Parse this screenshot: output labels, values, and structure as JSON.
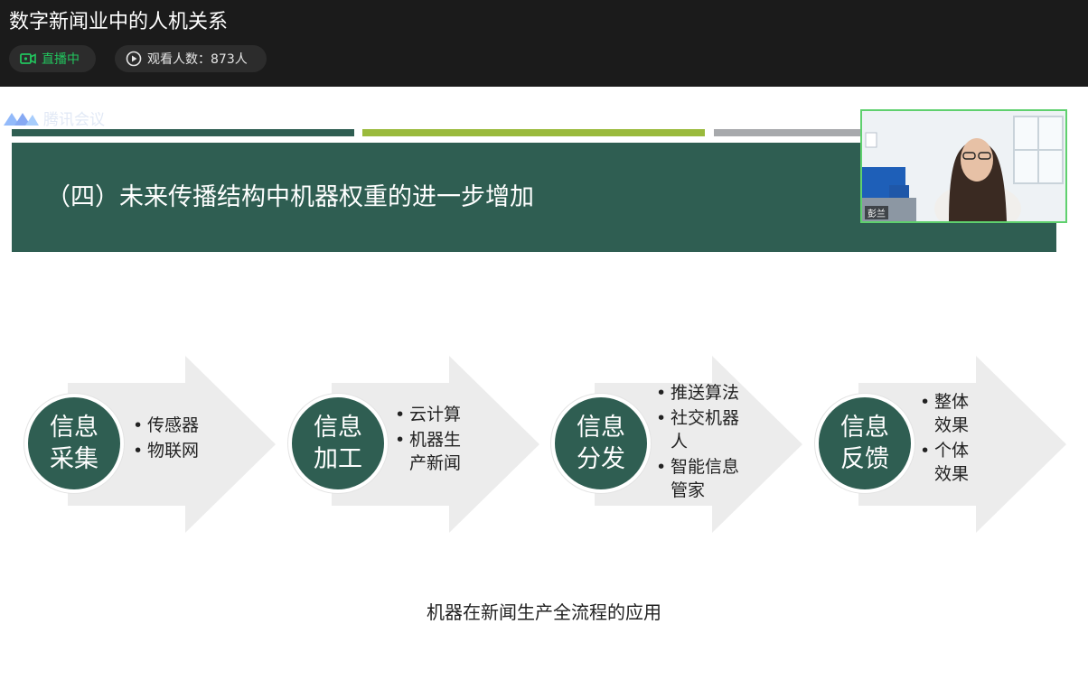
{
  "window": {
    "title": "数字新闻业中的人机关系"
  },
  "status": {
    "live_label": "直播中",
    "viewers_label": "观看人数：873人"
  },
  "watermark": {
    "text": "腾讯会议"
  },
  "slide": {
    "heading": "（四）未来传播结构中机器权重的进一步增加",
    "stripe_colors": [
      "#2f5e52",
      "#9aba3c",
      "#a7a9ac"
    ],
    "steps": [
      {
        "line1": "信息",
        "line2": "采集",
        "bullets": [
          "传感器",
          "物联网"
        ]
      },
      {
        "line1": "信息",
        "line2": "加工",
        "bullets": [
          "云计算",
          "机器生\n产新闻"
        ]
      },
      {
        "line1": "信息",
        "line2": "分发",
        "bullets": [
          "推送算法",
          "社交机器\n人",
          "智能信息\n管家"
        ]
      },
      {
        "line1": "信息",
        "line2": "反馈",
        "bullets": [
          "整体\n效果",
          "个体\n效果"
        ]
      }
    ],
    "caption": "机器在新闻生产全流程的应用"
  },
  "video": {
    "name": "彭兰"
  },
  "colors": {
    "accent": "#2f5e52",
    "live": "#22c55e"
  }
}
